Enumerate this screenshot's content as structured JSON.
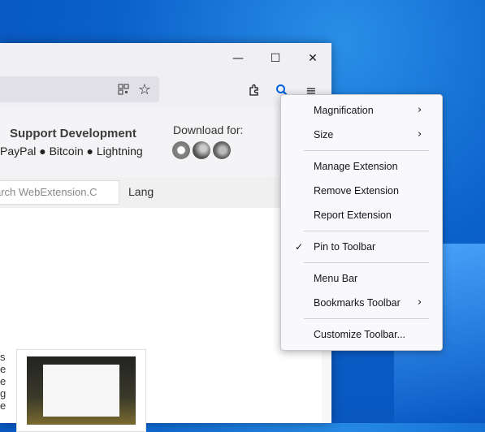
{
  "banner": {
    "support_title": "Support Development",
    "support_methods": "PayPal ● Bitcoin ● Lightning",
    "download_label": "Download for:",
    "browsers": [
      "chrome-logo",
      "edge-logo",
      "firefox-logo"
    ]
  },
  "search": {
    "value": "arch WebExtension.C",
    "lang_label": "Lang"
  },
  "side_text": [
    "s",
    "e",
    "e",
    "g",
    "e"
  ],
  "menu": {
    "items": [
      {
        "label": "Magnification",
        "has_submenu": true,
        "checked": false
      },
      {
        "label": "Size",
        "has_submenu": true,
        "checked": false
      },
      {
        "label": "Manage Extension",
        "has_submenu": false,
        "checked": false
      },
      {
        "label": "Remove Extension",
        "has_submenu": false,
        "checked": false
      },
      {
        "label": "Report Extension",
        "has_submenu": false,
        "checked": false
      },
      {
        "label": "Pin to Toolbar",
        "has_submenu": false,
        "checked": true
      },
      {
        "label": "Menu Bar",
        "has_submenu": false,
        "checked": false
      },
      {
        "label": "Bookmarks Toolbar",
        "has_submenu": true,
        "checked": false
      },
      {
        "label": "Customize Toolbar...",
        "has_submenu": false,
        "checked": false
      }
    ],
    "chevron": "›",
    "checkmark": "✓"
  },
  "colors": {
    "accent": "#0060df",
    "desktop": "#0a60c9"
  }
}
